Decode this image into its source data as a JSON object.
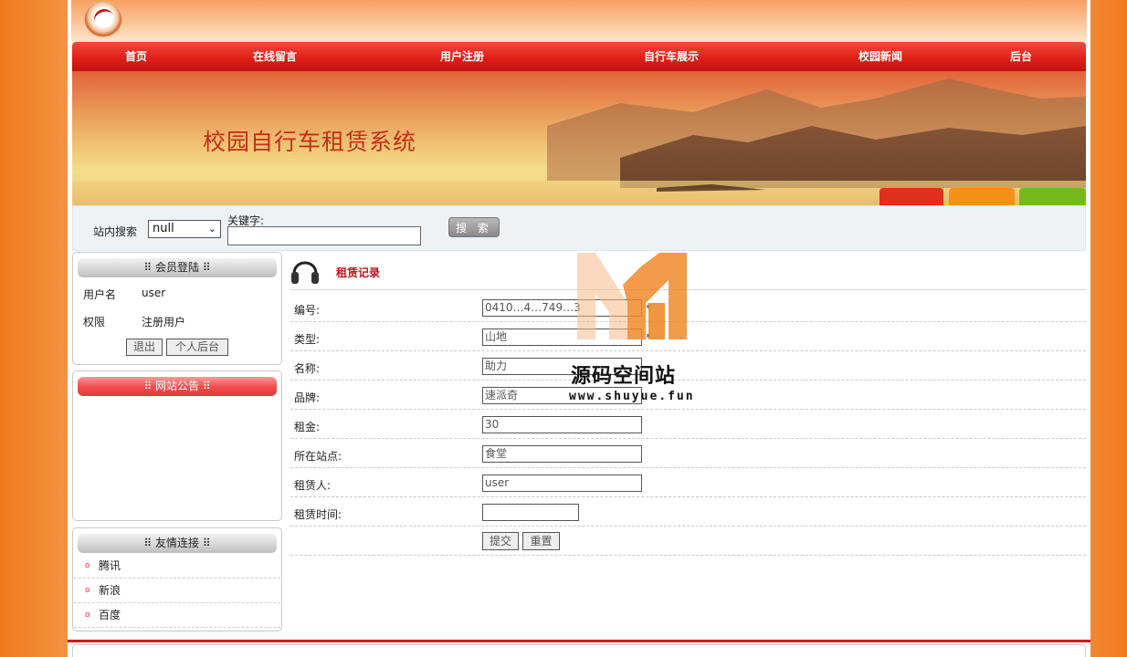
{
  "nav": {
    "items": [
      "首页",
      "在线留言",
      "用户注册",
      "自行车展示",
      "校园新闻",
      "后台"
    ]
  },
  "banner": {
    "title": "校园自行车租赁系统"
  },
  "search": {
    "label": "站内搜索",
    "select_value": "null",
    "keyword_label": "关键字:",
    "button_label": "搜 索"
  },
  "login": {
    "title": "会员登陆",
    "username_label": "用户名",
    "username_value": "user",
    "role_label": "权限",
    "role_value": "注册用户",
    "logout_label": "退出",
    "backend_label": "个人后台"
  },
  "notice": {
    "title": "网站公告"
  },
  "links": {
    "title": "友情连接",
    "items": [
      "腾讯",
      "新浪",
      "百度"
    ]
  },
  "form": {
    "title": "租赁记录",
    "fields": [
      {
        "label": "编号:",
        "value": "0410…4…749…3",
        "required": "*"
      },
      {
        "label": "类型:",
        "value": "山地",
        "required": "*"
      },
      {
        "label": "名称:",
        "value": "助力",
        "required": ""
      },
      {
        "label": "品牌:",
        "value": "速派奇",
        "required": ""
      },
      {
        "label": "租金:",
        "value": "30",
        "required": ""
      },
      {
        "label": "所在站点:",
        "value": "食堂",
        "required": ""
      },
      {
        "label": "租赁人:",
        "value": "user",
        "required": ""
      },
      {
        "label": "租赁时间:",
        "value": "",
        "required": ""
      }
    ],
    "submit_label": "提交",
    "reset_label": "重置"
  },
  "watermark": {
    "title": "源码空间站",
    "url": "www.shuyue.fun"
  },
  "colors": {
    "nav_red": "#e02018",
    "accent_orange": "#f07a1e",
    "title_red": "#c0101a"
  }
}
